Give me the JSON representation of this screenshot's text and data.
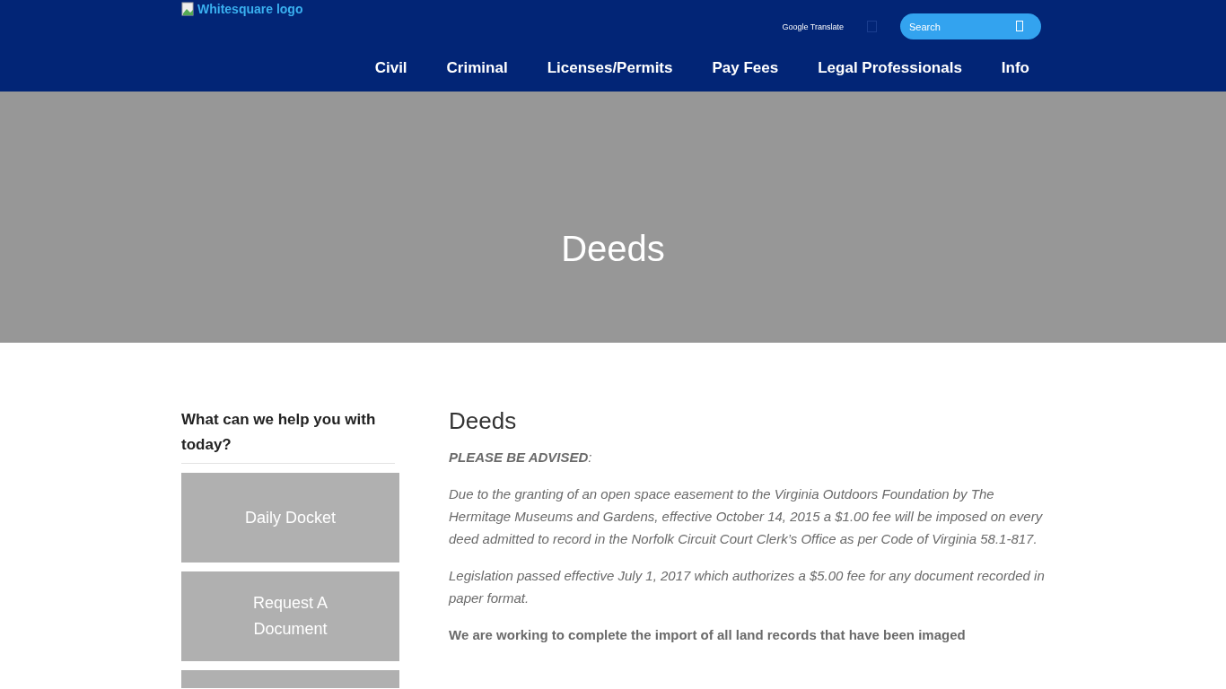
{
  "header": {
    "logo_alt": "Whitesquare logo",
    "translate_label": "Google Translate",
    "search": {
      "placeholder": "Search"
    },
    "nav": [
      {
        "label": "Civil"
      },
      {
        "label": "Criminal"
      },
      {
        "label": "Licenses/Permits"
      },
      {
        "label": "Pay Fees"
      },
      {
        "label": "Legal Professionals"
      },
      {
        "label": "Info"
      }
    ]
  },
  "hero": {
    "title": "Deeds"
  },
  "sidebar": {
    "heading": "What can we help you with today?",
    "tiles": [
      {
        "kind": "labeled",
        "label": "Daily Docket"
      },
      {
        "kind": "labeled",
        "label": "Request A Document"
      },
      {
        "kind": "blank"
      }
    ]
  },
  "content": {
    "title": "Deeds",
    "paragraphs": [
      {
        "kind": "italic",
        "text": "**PLEASE BE ADVISED**:"
      },
      {
        "kind": "italic",
        "text": "Due to the granting of an open space easement to the Virginia Outdoors Foundation by The Hermitage Museums and Gardens, effective October 14, 2015 a $1.00 fee will be imposed on every deed admitted to record in the Norfolk Circuit Court Clerk’s Office as per Code of Virginia 58.1-817."
      },
      {
        "kind": "italic",
        "text": "Legislation passed effective July 1, 2017 which authorizes a $5.00 fee for any document recorded in paper format."
      },
      {
        "kind": "bold",
        "text": "We are working to complete the import of all land records that have been imaged"
      }
    ]
  }
}
